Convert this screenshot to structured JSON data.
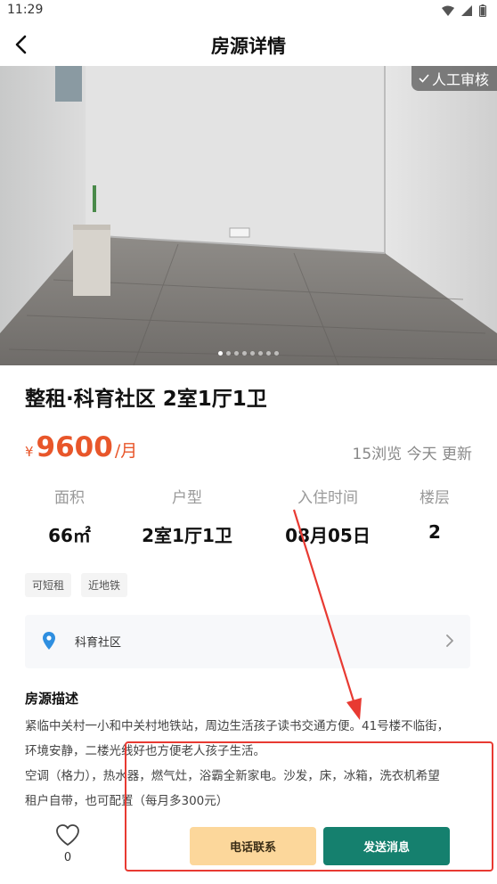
{
  "status_bar": {
    "time": "11:29"
  },
  "header": {
    "title": "房源详情"
  },
  "photo": {
    "badge": "人工审核",
    "slide_count": 8,
    "active_slide": 1
  },
  "listing": {
    "title": "整租·科育社区 2室1厅1卫",
    "price": {
      "symbol": "¥",
      "value": "9600",
      "unit": "/月"
    },
    "stats": "15浏览 今天 更新"
  },
  "specs": [
    {
      "label": "面积",
      "value": "66㎡"
    },
    {
      "label": "户型",
      "value": "2室1厅1卫"
    },
    {
      "label": "入住时间",
      "value": "08月05日"
    },
    {
      "label": "楼层",
      "value": "2"
    }
  ],
  "tags": [
    "可短租",
    "近地铁"
  ],
  "location": {
    "name": "科育社区"
  },
  "description": {
    "title": "房源描述",
    "lines": [
      "紧临中关村一小和中关村地铁站，周边生活孩子读书交通方便。41号楼不临街，",
      "环境安静，二楼光线好也方便老人孩子生活。",
      "空调（格力），热水器，燃气灶，浴霸全新家电。沙发，床，冰箱，洗衣机希望",
      "租户自带，也可配置（每月多300元）"
    ]
  },
  "bottom_bar": {
    "like_count": "0",
    "phone_label": "电话联系",
    "message_label": "发送消息"
  },
  "colors": {
    "price": "#e8562a",
    "primary_button": "#15806e",
    "secondary_button": "#fcd79b",
    "annotation": "#e83a32",
    "location_pin": "#2f8fe0"
  }
}
